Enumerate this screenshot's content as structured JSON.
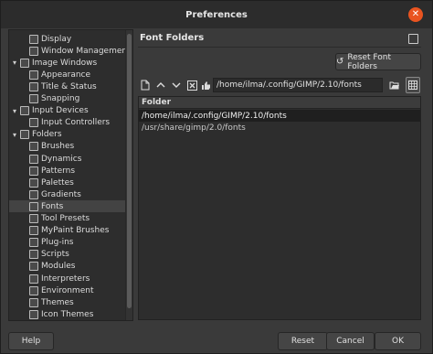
{
  "window": {
    "title": "Preferences",
    "close_glyph": "✕"
  },
  "tree": {
    "items": [
      {
        "label": "Display",
        "level": 1,
        "expander": "",
        "icon": "display-icon"
      },
      {
        "label": "Window Management",
        "level": 1,
        "expander": "",
        "icon": "window-management-icon"
      },
      {
        "label": "Image Windows",
        "level": 0,
        "expander": "▾",
        "icon": "image-windows-icon"
      },
      {
        "label": "Appearance",
        "level": 1,
        "expander": "",
        "icon": "appearance-icon"
      },
      {
        "label": "Title & Status",
        "level": 1,
        "expander": "",
        "icon": "title-status-icon"
      },
      {
        "label": "Snapping",
        "level": 1,
        "expander": "",
        "icon": "snapping-icon"
      },
      {
        "label": "Input Devices",
        "level": 0,
        "expander": "▾",
        "icon": "input-devices-icon"
      },
      {
        "label": "Input Controllers",
        "level": 1,
        "expander": "",
        "icon": "input-controllers-icon"
      },
      {
        "label": "Folders",
        "level": 0,
        "expander": "▾",
        "icon": "folders-icon"
      },
      {
        "label": "Brushes",
        "level": 1,
        "expander": "",
        "icon": "brushes-icon"
      },
      {
        "label": "Dynamics",
        "level": 1,
        "expander": "",
        "icon": "dynamics-icon"
      },
      {
        "label": "Patterns",
        "level": 1,
        "expander": "",
        "icon": "patterns-icon"
      },
      {
        "label": "Palettes",
        "level": 1,
        "expander": "",
        "icon": "palettes-icon"
      },
      {
        "label": "Gradients",
        "level": 1,
        "expander": "",
        "icon": "gradients-icon"
      },
      {
        "label": "Fonts",
        "level": 1,
        "expander": "",
        "icon": "fonts-icon"
      },
      {
        "label": "Tool Presets",
        "level": 1,
        "expander": "",
        "icon": "tool-presets-icon"
      },
      {
        "label": "MyPaint Brushes",
        "level": 1,
        "expander": "",
        "icon": "mypaint-brushes-icon"
      },
      {
        "label": "Plug-ins",
        "level": 1,
        "expander": "",
        "icon": "plug-ins-icon"
      },
      {
        "label": "Scripts",
        "level": 1,
        "expander": "",
        "icon": "scripts-icon"
      },
      {
        "label": "Modules",
        "level": 1,
        "expander": "",
        "icon": "modules-icon"
      },
      {
        "label": "Interpreters",
        "level": 1,
        "expander": "",
        "icon": "interpreters-icon"
      },
      {
        "label": "Environment",
        "level": 1,
        "expander": "",
        "icon": "environment-icon"
      },
      {
        "label": "Themes",
        "level": 1,
        "expander": "",
        "icon": "themes-icon"
      },
      {
        "label": "Icon Themes",
        "level": 1,
        "expander": "",
        "icon": "icon-themes-icon"
      }
    ],
    "selected": "Fonts"
  },
  "panel": {
    "title": "Font Folders",
    "reset_button_label": "Reset Font Folders",
    "path_value": "/home/ilma/.config/GIMP/2.10/fonts",
    "list_header": "Folder",
    "folders": [
      {
        "path": "/home/ilma/.config/GIMP/2.10/fonts",
        "selected": true
      },
      {
        "path": "/usr/share/gimp/2.0/fonts",
        "selected": false
      }
    ]
  },
  "toolbar": {
    "new_icon": "new-folder-icon",
    "up_icon": "move-up-icon",
    "down_icon": "move-down-icon",
    "delete_icon": "delete-icon",
    "writable_icon": "writable-icon",
    "browse_icon": "browse-folder-icon",
    "grid_icon": "grid-view-icon"
  },
  "footer": {
    "help_label": "Help",
    "reset_label": "Reset",
    "cancel_label": "Cancel",
    "ok_label": "OK"
  },
  "colors": {
    "accent_close": "#e95420",
    "selection_tree": "#434343",
    "selection_list": "#1f1f1f"
  }
}
